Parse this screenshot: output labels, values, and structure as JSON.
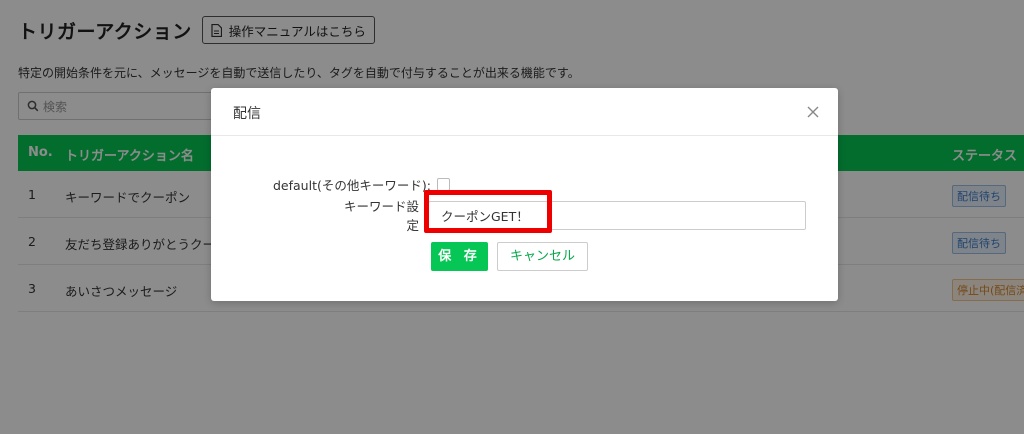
{
  "page": {
    "title": "トリガーアクション",
    "manual_button": "操作マニュアルはこちら",
    "description": "特定の開始条件を元に、メッセージを自動で送信したり、タグを自動で付与することが出来る機能です。",
    "search_placeholder": "検索"
  },
  "table": {
    "headers": {
      "no": "No.",
      "name": "トリガーアクション名",
      "status": "ステータス"
    },
    "rows": [
      {
        "no": "1",
        "name": "キーワードでクーポン",
        "status": "配信待ち",
        "status_color": "#3d7ac7"
      },
      {
        "no": "2",
        "name": "友だち登録ありがとうクー",
        "status": "配信待ち",
        "status_color": "#3d7ac7"
      },
      {
        "no": "3",
        "name": "あいさつメッセージ",
        "status": "停止中(配信済",
        "status_color": "#d4862b"
      }
    ]
  },
  "modal": {
    "title": "配信",
    "default_label": "default(その他キーワード):",
    "default_checked": false,
    "keyword_label": "キーワード設定",
    "keyword_value": "クーポンGET！",
    "save_label": "保 存",
    "cancel_label": "キャンセル"
  },
  "colors": {
    "accent": "#06c755",
    "highlight": "#ee0000"
  }
}
